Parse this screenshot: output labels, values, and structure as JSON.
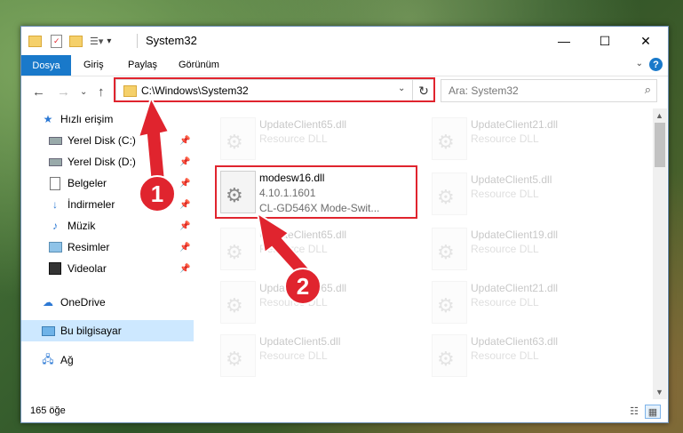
{
  "window": {
    "title": "System32",
    "minimize": "—",
    "maximize": "☐",
    "close": "✕"
  },
  "ribbon": {
    "tabs": [
      "Dosya",
      "Giriş",
      "Paylaş",
      "Görünüm"
    ],
    "help": "?"
  },
  "nav": {
    "address": "C:\\Windows\\System32",
    "search_placeholder": "Ara: System32"
  },
  "sidebar": {
    "items": [
      {
        "label": "Hızlı erişim",
        "icon": "star-icon"
      },
      {
        "label": "Yerel Disk (C:)",
        "icon": "drive-icon"
      },
      {
        "label": "Yerel Disk (D:)",
        "icon": "drive-icon"
      },
      {
        "label": "Belgeler",
        "icon": "documents-icon"
      },
      {
        "label": "İndirmeler",
        "icon": "downloads-icon"
      },
      {
        "label": "Müzik",
        "icon": "music-icon"
      },
      {
        "label": "Resimler",
        "icon": "pictures-icon"
      },
      {
        "label": "Videolar",
        "icon": "videos-icon"
      },
      {
        "label": "OneDrive",
        "icon": "cloud-icon"
      },
      {
        "label": "Bu bilgisayar",
        "icon": "computer-icon"
      },
      {
        "label": "Ağ",
        "icon": "network-icon"
      }
    ]
  },
  "files": {
    "highlighted": {
      "name": "modesw16.dll",
      "version": "4.10.1.1601",
      "description": "CL-GD546X Mode-Swit..."
    },
    "ghost": [
      {
        "name": "UpdateClient65.dll",
        "type": "Resource DLL"
      },
      {
        "name": "UpdateClient21.dll",
        "type": "Resource DLL"
      },
      {
        "name": "UpdateClient5.dll",
        "type": "Resource DLL"
      },
      {
        "name": "UpdateClient65.dll",
        "type": "Resource DLL"
      },
      {
        "name": "UpdateClient19.dll",
        "type": "Resource DLL"
      },
      {
        "name": "UpdateClient65.dll",
        "type": "Resource DLL"
      },
      {
        "name": "UpdateClient21.dll",
        "type": "Resource DLL"
      },
      {
        "name": "UpdateClient5.dll",
        "type": "Resource DLL"
      },
      {
        "name": "UpdateClient63.dll",
        "type": "Resource DLL"
      }
    ]
  },
  "status": {
    "count": "165 öğe"
  },
  "callouts": {
    "one": "1",
    "two": "2"
  },
  "colors": {
    "accent": "#1979ca",
    "highlight": "#e0242e",
    "selected": "#cde8ff"
  }
}
